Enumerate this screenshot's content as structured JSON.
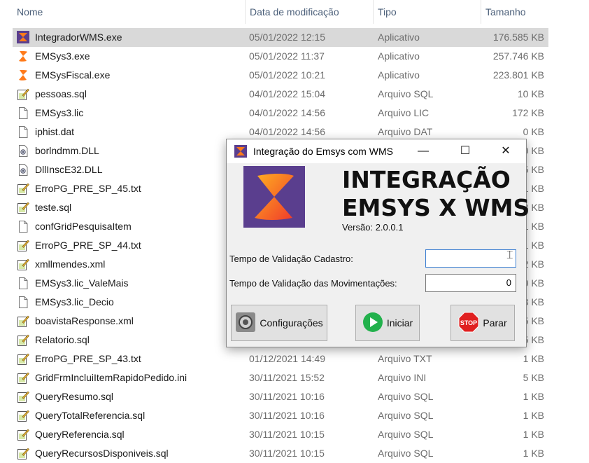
{
  "explorer": {
    "columns": {
      "name": "Nome",
      "date": "Data de modificação",
      "type": "Tipo",
      "size": "Tamanho"
    },
    "files": [
      {
        "name": "IntegradorWMS.exe",
        "date": "05/01/2022 12:15",
        "type": "Aplicativo",
        "size": "176.585 KB",
        "icon": "app-integrador-icon",
        "selected": true
      },
      {
        "name": "EMSys3.exe",
        "date": "05/01/2022 11:37",
        "type": "Aplicativo",
        "size": "257.746 KB",
        "icon": "app-emsys-icon"
      },
      {
        "name": "EMSysFiscal.exe",
        "date": "05/01/2022 10:21",
        "type": "Aplicativo",
        "size": "223.801 KB",
        "icon": "app-emsys-icon"
      },
      {
        "name": "pessoas.sql",
        "date": "04/01/2022 15:04",
        "type": "Arquivo SQL",
        "size": "10 KB",
        "icon": "edit-file-icon"
      },
      {
        "name": "EMSys3.lic",
        "date": "04/01/2022 14:56",
        "type": "Arquivo LIC",
        "size": "172 KB",
        "icon": "blank-file-icon"
      },
      {
        "name": "iphist.dat",
        "date": "04/01/2022 14:56",
        "type": "Arquivo DAT",
        "size": "0 KB",
        "icon": "blank-file-icon"
      },
      {
        "name": "borlndmm.DLL",
        "date": "",
        "type": "",
        "size": "0 KB",
        "icon": "dll-file-icon"
      },
      {
        "name": "DllInscE32.DLL",
        "date": "",
        "type": "",
        "size": "5 KB",
        "icon": "dll-file-icon"
      },
      {
        "name": "ErroPG_PRE_SP_45.txt",
        "date": "",
        "type": "",
        "size": "1 KB",
        "icon": "edit-file-icon"
      },
      {
        "name": "teste.sql",
        "date": "",
        "type": "",
        "size": "3 KB",
        "icon": "edit-file-icon"
      },
      {
        "name": "confGridPesquisaItem",
        "date": "",
        "type": "",
        "size": "1 KB",
        "icon": "blank-file-icon"
      },
      {
        "name": "ErroPG_PRE_SP_44.txt",
        "date": "",
        "type": "",
        "size": "1 KB",
        "icon": "edit-file-icon"
      },
      {
        "name": "xmllmendes.xml",
        "date": "",
        "type": "",
        "size": "2 KB",
        "icon": "edit-file-icon"
      },
      {
        "name": "EMSys3.lic_ValeMais",
        "date": "",
        "type": "",
        "size": "0 KB",
        "icon": "blank-file-icon"
      },
      {
        "name": "EMSys3.lic_Decio",
        "date": "",
        "type": "",
        "size": "3 KB",
        "icon": "blank-file-icon"
      },
      {
        "name": "boavistaResponse.xml",
        "date": "",
        "type": "",
        "size": "5 KB",
        "icon": "edit-file-icon"
      },
      {
        "name": "Relatorio.sql",
        "date": "",
        "type": "",
        "size": "5 KB",
        "icon": "edit-file-icon"
      },
      {
        "name": "ErroPG_PRE_SP_43.txt",
        "date": "01/12/2021 14:49",
        "type": "Arquivo TXT",
        "size": "1 KB",
        "icon": "edit-file-icon"
      },
      {
        "name": "GridFrmIncluiItemRapidoPedido.ini",
        "date": "30/11/2021 15:52",
        "type": "Arquivo INI",
        "size": "5 KB",
        "icon": "edit-file-icon"
      },
      {
        "name": "QueryResumo.sql",
        "date": "30/11/2021 10:16",
        "type": "Arquivo SQL",
        "size": "1 KB",
        "icon": "edit-file-icon"
      },
      {
        "name": "QueryTotalReferencia.sql",
        "date": "30/11/2021 10:16",
        "type": "Arquivo SQL",
        "size": "1 KB",
        "icon": "edit-file-icon"
      },
      {
        "name": "QueryReferencia.sql",
        "date": "30/11/2021 10:15",
        "type": "Arquivo SQL",
        "size": "1 KB",
        "icon": "edit-file-icon"
      },
      {
        "name": "QueryRecursosDisponiveis.sql",
        "date": "30/11/2021 10:15",
        "type": "Arquivo SQL",
        "size": "1 KB",
        "icon": "edit-file-icon"
      }
    ]
  },
  "dialog": {
    "title": "Integração do Emsys com WMS",
    "heading_line1": "INTEGRAÇÃO",
    "heading_line2": "EMSYS X WMS",
    "version": "Versão: 2.0.0.1",
    "fields": {
      "cadastro_label": "Tempo de Validação Cadastro:",
      "cadastro_value": "",
      "movimentacoes_label": "Tempo de Validação das Movimentações:",
      "movimentacoes_value": "0"
    },
    "buttons": {
      "config": "Configurações",
      "start": "Iniciar",
      "stop": "Parar",
      "stop_icon_text": "STOP"
    },
    "colors": {
      "logo_bg": "#5a3e8e",
      "logo_orange": "#ff7a1a",
      "start_green": "#22b14c",
      "stop_red": "#e02020"
    }
  }
}
